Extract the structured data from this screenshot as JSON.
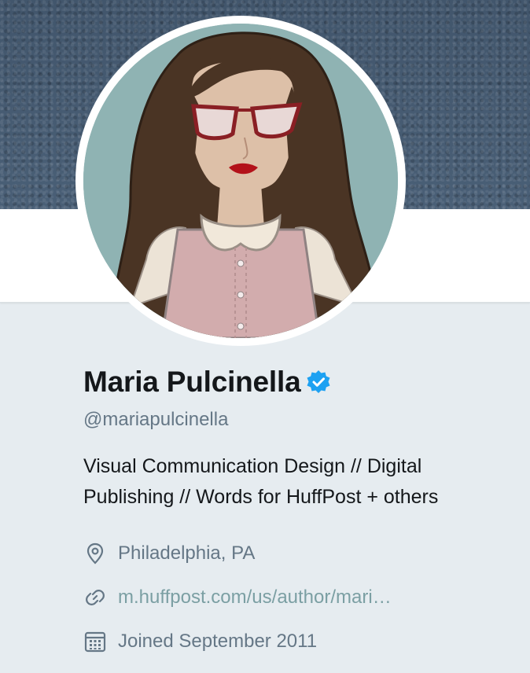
{
  "profile": {
    "name": "Maria Pulcinella",
    "handle": "@mariapulcinella",
    "verified": true,
    "bio_line1": "Visual Communication Design // Digital",
    "bio_line2": "Publishing // Words for HuffPost + others",
    "location": "Philadelphia, PA",
    "website": "m.huffpost.com/us/author/mari…",
    "joined": "Joined September 2011"
  },
  "icons": {
    "verified": "verified-badge-icon",
    "location": "location-pin-icon",
    "website": "link-icon",
    "joined": "calendar-icon"
  },
  "colors": {
    "background": "#e6ecf0",
    "verified": "#1da1f2",
    "secondary_text": "#657786",
    "link": "#7b9fa3"
  }
}
